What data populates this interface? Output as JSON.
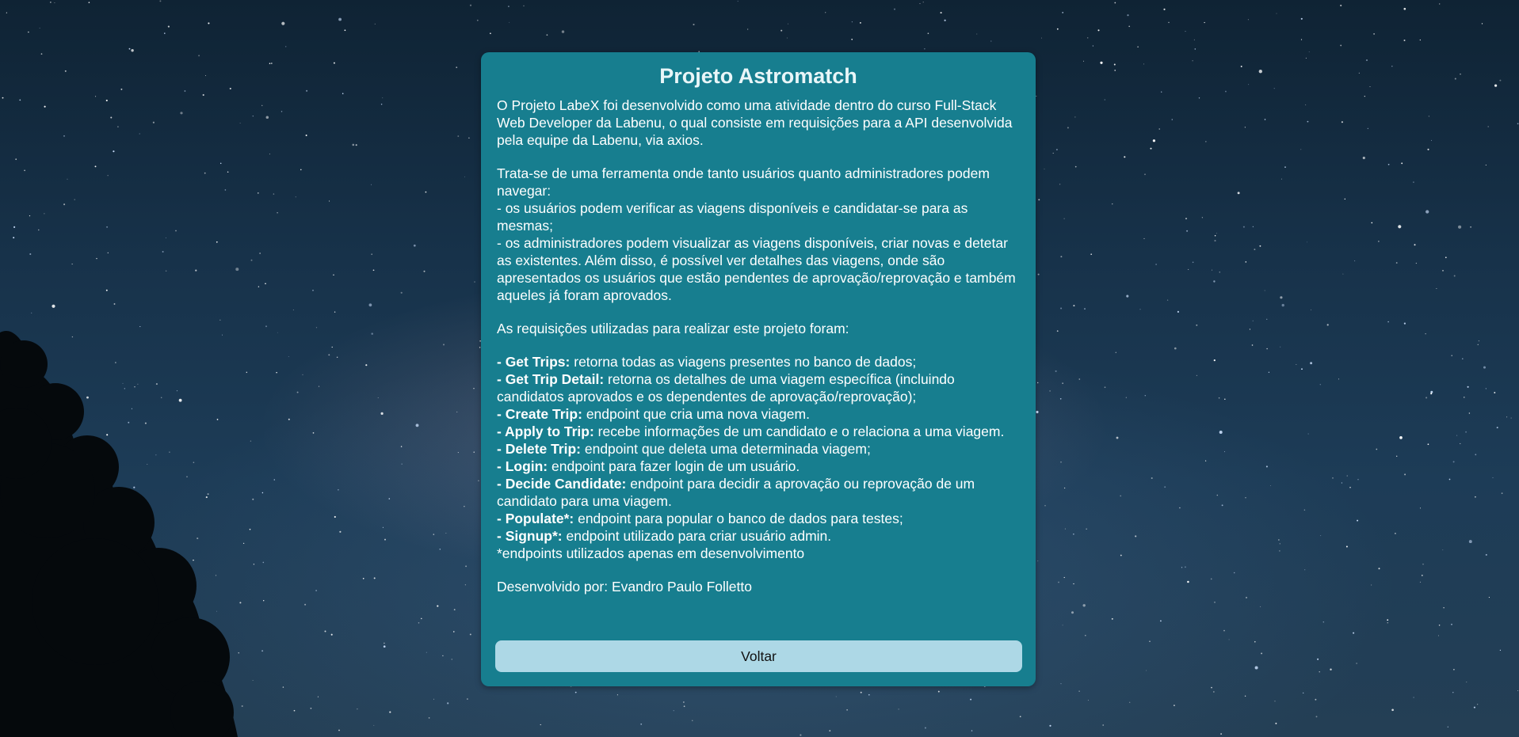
{
  "page": {
    "background_name": "starry-night-sky-background"
  },
  "card": {
    "title": "Projeto Astromatch",
    "intro": "O Projeto LabeX foi desenvolvido como uma atividade dentro do curso Full-Stack Web Developer da Labenu, o qual consiste em requisições para a API desenvolvida pela equipe da Labenu, via axios.",
    "description": {
      "lead": "Trata-se de uma ferramenta onde tanto usuários quanto administradores podem navegar:",
      "users": "- os usuários podem verificar as viagens disponíveis e candidatar-se para as mesmas;",
      "admins": "- os administradores podem visualizar as viagens disponíveis, criar novas e detetar as existentes. Além disso, é possível ver detalhes das viagens, onde são apresentados os usuários que estão pendentes de aprovação/reprovação e também aqueles já foram aprovados."
    },
    "requests_intro": "As requisições utilizadas para realizar este projeto foram:",
    "endpoints": [
      {
        "name": "- Get Trips:",
        "text": " retorna todas as viagens presentes no banco de dados;"
      },
      {
        "name": "- Get Trip Detail:",
        "text": " retorna os detalhes de uma viagem específica (incluindo candidatos aprovados e os dependentes de aprovação/reprovação);"
      },
      {
        "name": "- Create Trip:",
        "text": " endpoint que cria uma nova viagem."
      },
      {
        "name": "- Apply to Trip:",
        "text": " recebe informações de um candidato e o relaciona a uma viagem."
      },
      {
        "name": "- Delete Trip:",
        "text": " endpoint que deleta uma determinada viagem;"
      },
      {
        "name": "- Login:",
        "text": " endpoint para fazer login de um usuário."
      },
      {
        "name": "- Decide Candidate:",
        "text": " endpoint para decidir a aprovação ou reprovação de um candidato para uma viagem."
      },
      {
        "name": "- Populate*:",
        "text": " endpoint para popular o banco de dados para testes;"
      },
      {
        "name": "- Signup*:",
        "text": " endpoint utilizado para criar usuário admin."
      }
    ],
    "footnote": "*endpoints utilizados apenas em desenvolvimento",
    "author": "Desenvolvido por: Evandro Paulo Folletto",
    "back_label": "Voltar"
  },
  "colors": {
    "card_background": "#177e8f",
    "button_background": "#add8e6",
    "text": "#ffffff"
  }
}
